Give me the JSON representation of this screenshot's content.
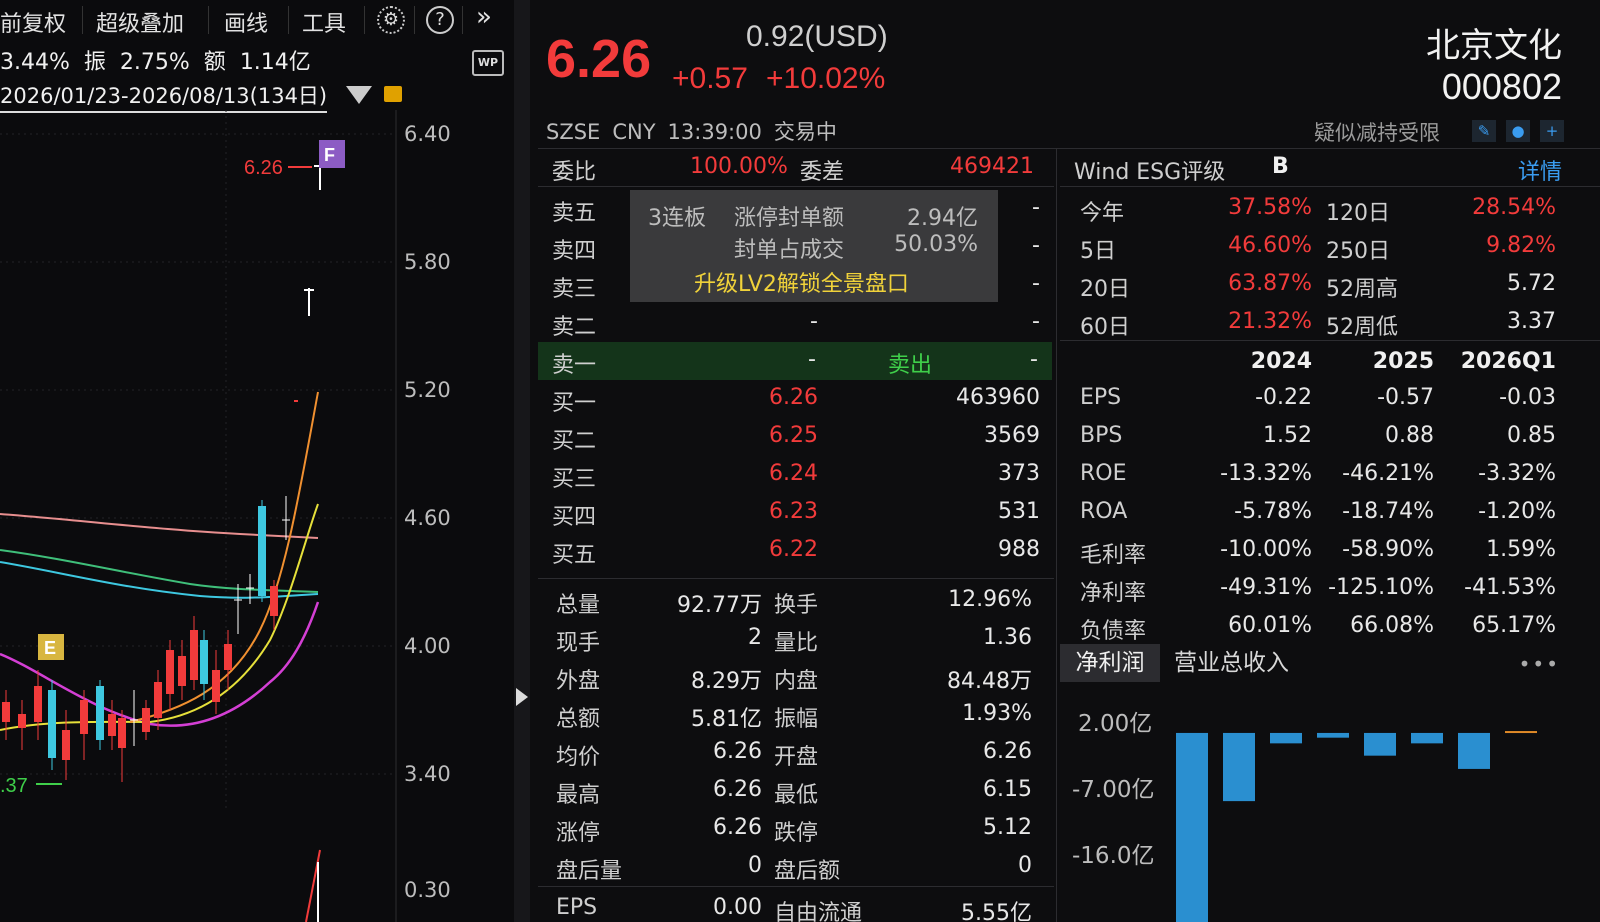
{
  "toolbar": {
    "items": [
      "前复权",
      "超级叠加",
      "画线",
      "工具"
    ],
    "settings_icon": "gear-icon",
    "help_icon": "question-icon",
    "expand_icon": "double-chevron-right-icon"
  },
  "kline": {
    "stats": {
      "change": "3.44%",
      "amplitude_label": "振",
      "amplitude": "2.75%",
      "amount_label": "额",
      "amount": "1.14亿"
    },
    "range": "2026/01/23-2026/08/13(134日)",
    "wp_label": "WP",
    "price_marker": "6.26",
    "low_marker": ".37",
    "marker_f": "F",
    "marker_e": "E",
    "y_labels": [
      "6.40",
      "5.80",
      "5.20",
      "4.60",
      "4.00",
      "3.40",
      "0.30"
    ]
  },
  "quote": {
    "price": "6.26",
    "usd": "0.92(USD)",
    "change": "+0.57",
    "change_pct": "+10.02%",
    "name": "北京文化",
    "code": "000802",
    "exchange": "SZSE",
    "currency": "CNY",
    "time": "13:39:00",
    "status": "交易中",
    "warning": "疑似减持受限",
    "colors": {
      "up": "#f23b3b",
      "down": "#3fcf4a"
    }
  },
  "orderbook": {
    "weibi_label": "委比",
    "weibi": "100.00%",
    "weicha_label": "委差",
    "weicha": "469421",
    "sell": [
      {
        "label": "卖五",
        "price": "",
        "vol": "-"
      },
      {
        "label": "卖四",
        "price": "",
        "vol": "-"
      },
      {
        "label": "卖三",
        "price": "",
        "vol": "-"
      },
      {
        "label": "卖二",
        "price": "-",
        "vol": "-"
      },
      {
        "label": "卖一",
        "price": "-",
        "vol": "-",
        "action": "卖出"
      }
    ],
    "buy": [
      {
        "label": "买一",
        "price": "6.26",
        "vol": "463960"
      },
      {
        "label": "买二",
        "price": "6.25",
        "vol": "3569"
      },
      {
        "label": "买三",
        "price": "6.24",
        "vol": "373"
      },
      {
        "label": "买四",
        "price": "6.23",
        "vol": "531"
      },
      {
        "label": "买五",
        "price": "6.22",
        "vol": "988"
      }
    ],
    "overlay": {
      "streak": "3连板",
      "seal_amount_label": "涨停封单额",
      "seal_amount": "2.94亿",
      "seal_ratio_label": "封单占成交",
      "seal_ratio": "50.03%",
      "upgrade": "升级LV2解锁全景盘口"
    }
  },
  "stats": [
    {
      "k1": "总量",
      "v1": "92.77万",
      "k2": "换手",
      "v2": "12.96%"
    },
    {
      "k1": "现手",
      "v1": "2",
      "k2": "量比",
      "v2": "1.36"
    },
    {
      "k1": "外盘",
      "v1": "8.29万",
      "k2": "内盘",
      "v2": "84.48万"
    },
    {
      "k1": "总额",
      "v1": "5.81亿",
      "k2": "振幅",
      "v2": "1.93%"
    },
    {
      "k1": "均价",
      "v1": "6.26",
      "k2": "开盘",
      "v2": "6.26"
    },
    {
      "k1": "最高",
      "v1": "6.26",
      "k2": "最低",
      "v2": "6.15"
    },
    {
      "k1": "涨停",
      "v1": "6.26",
      "k2": "跌停",
      "v2": "5.12"
    },
    {
      "k1": "盘后量",
      "v1": "0",
      "k2": "盘后额",
      "v2": "0"
    },
    {
      "k1": "EPS",
      "v1": "0.00",
      "k2": "自由流通",
      "v2": "5.55亿"
    }
  ],
  "esg": {
    "label": "Wind ESG评级",
    "grade": "B",
    "detail": "详情"
  },
  "performance": [
    {
      "a": "今年",
      "b": "37.58%",
      "c": "120日",
      "d": "28.54%"
    },
    {
      "a": "5日",
      "b": "46.60%",
      "c": "250日",
      "d": "9.82%"
    },
    {
      "a": "20日",
      "b": "63.87%",
      "c": "52周高",
      "d": "5.72"
    },
    {
      "a": "60日",
      "b": "21.32%",
      "c": "52周低",
      "d": "3.37"
    }
  ],
  "financials": {
    "years": [
      "2024",
      "2025",
      "2026Q1"
    ],
    "rows": [
      {
        "label": "EPS",
        "values": [
          "-0.22",
          "-0.57",
          "-0.03"
        ]
      },
      {
        "label": "BPS",
        "values": [
          "1.52",
          "0.88",
          "0.85"
        ]
      },
      {
        "label": "ROE",
        "values": [
          "-13.32%",
          "-46.21%",
          "-3.32%"
        ]
      },
      {
        "label": "ROA",
        "values": [
          "-5.78%",
          "-18.74%",
          "-1.20%"
        ]
      },
      {
        "label": "毛利率",
        "values": [
          "-10.00%",
          "-58.90%",
          "1.59%"
        ]
      },
      {
        "label": "净利率",
        "values": [
          "-49.31%",
          "-125.10%",
          "-41.53%"
        ]
      },
      {
        "label": "负债率",
        "values": [
          "60.01%",
          "66.08%",
          "65.17%"
        ]
      }
    ]
  },
  "profit_tabs": {
    "active": "净利润",
    "other": "营业总收入",
    "more": "•••"
  },
  "chart_data": {
    "type": "bar",
    "y_tick_labels": [
      "2.00亿",
      "-7.00亿",
      "-16.0亿"
    ],
    "ylim": [
      -22.5,
      2.0
    ],
    "values": [
      -22.4,
      -7.2,
      -1.1,
      -0.5,
      -2.4,
      -1.1,
      -3.8,
      0.2
    ],
    "colors": [
      "#2a8fd0",
      "#2a8fd0",
      "#2a8fd0",
      "#2a8fd0",
      "#2a8fd0",
      "#2a8fd0",
      "#2a8fd0",
      "#e08a28"
    ]
  }
}
